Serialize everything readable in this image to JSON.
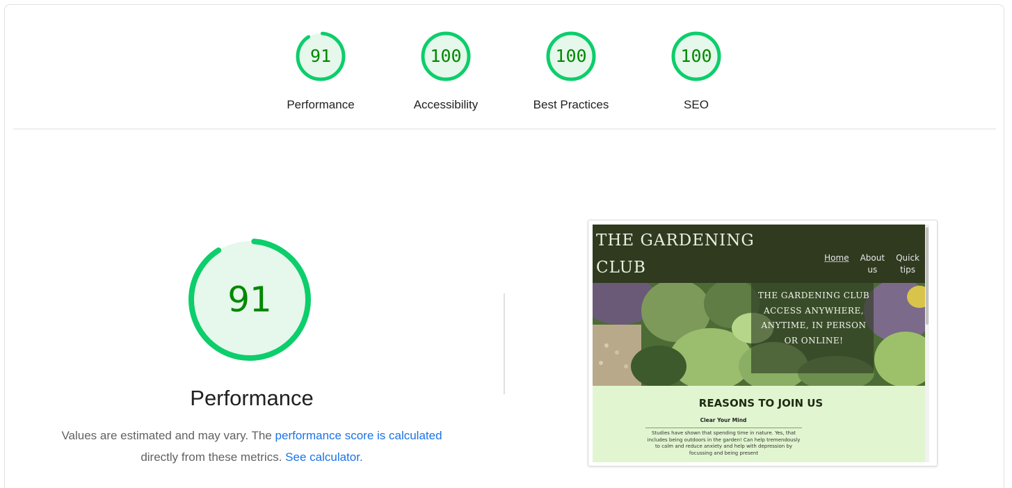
{
  "colors": {
    "gauge_good": "#0cce6b",
    "gauge_fill": "#e6f7ec",
    "score_text": "#008800",
    "link": "#1a73e8"
  },
  "gauges": [
    {
      "score": "91",
      "label": "Performance",
      "fraction": 0.91
    },
    {
      "score": "100",
      "label": "Accessibility",
      "fraction": 1.0
    },
    {
      "score": "100",
      "label": "Best Practices",
      "fraction": 1.0
    },
    {
      "score": "100",
      "label": "SEO",
      "fraction": 1.0
    }
  ],
  "main": {
    "score": "91",
    "fraction": 0.91,
    "title": "Performance",
    "desc_prefix": "Values are estimated and may vary. The ",
    "desc_link1": "performance score is calculated",
    "desc_middle": " directly from these metrics. ",
    "desc_link2": "See calculator."
  },
  "screenshot": {
    "logo_line1": "THE GARDENING",
    "logo_line2": "CLUB",
    "nav": [
      {
        "line1": "Home",
        "line2": ""
      },
      {
        "line1": "About",
        "line2": "us"
      },
      {
        "line1": "Quick",
        "line2": "tips"
      }
    ],
    "hero_text": "THE GARDENING CLUB ACCESS ANYWHERE, ANYTIME, IN PERSON OR ONLINE!",
    "section_title": "REASONS TO JOIN US",
    "subheading": "Clear Your Mind",
    "body_text": "Studies have shown that spending time in nature. Yes, that includes being outdoors in the garden! Can help tremendously to calm and reduce anxiety and help with depression by focussing and being present"
  }
}
